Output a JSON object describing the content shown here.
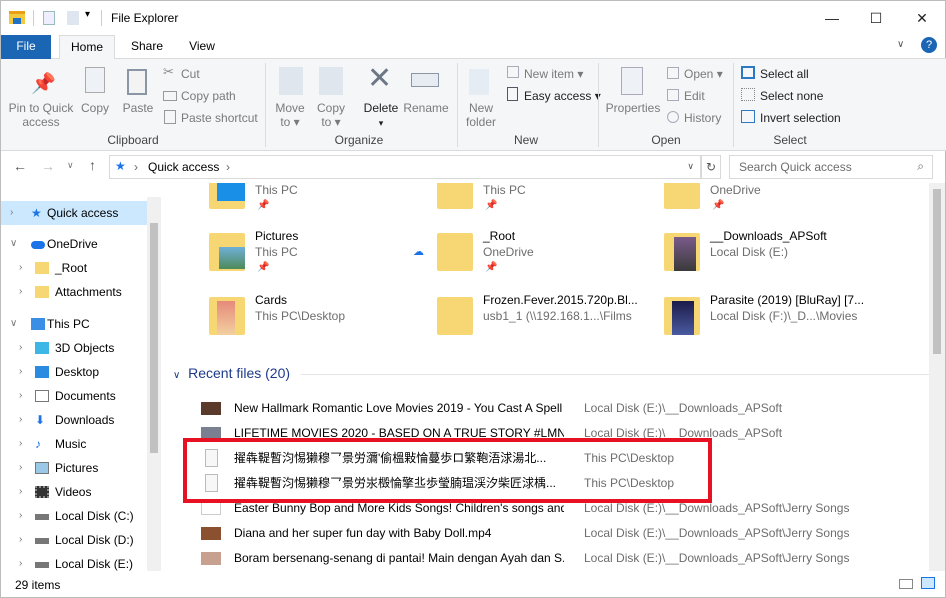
{
  "window": {
    "title": "File Explorer",
    "minimize": "—",
    "maximize": "☐",
    "close": "✕",
    "help": "?"
  },
  "tabs": [
    {
      "label": "File"
    },
    {
      "label": "Home"
    },
    {
      "label": "Share"
    },
    {
      "label": "View"
    }
  ],
  "ribbon": {
    "clipboard": {
      "group": "Clipboard",
      "pin": "Pin to Quick access",
      "pin1": "Pin to Quick",
      "pin2": "access",
      "copy": "Copy",
      "paste": "Paste",
      "cut": "Cut",
      "copy_path": "Copy path",
      "paste_shortcut": "Paste shortcut"
    },
    "organize": {
      "group": "Organize",
      "move1": "Move",
      "move2": "to ▾",
      "copy1": "Copy",
      "copy2": "to ▾",
      "delete": "Delete",
      "delete_arrow": "▾",
      "rename": "Rename"
    },
    "new": {
      "group": "New",
      "folder1": "New",
      "folder2": "folder",
      "new_item": "New item ▾",
      "easy_access": "Easy access ▾"
    },
    "open": {
      "group": "Open",
      "properties": "Properties",
      "open": "Open ▾",
      "edit": "Edit",
      "history": "History"
    },
    "select": {
      "group": "Select",
      "all": "Select all",
      "none": "Select none",
      "invert": "Invert selection"
    }
  },
  "address": {
    "path": "Quick access",
    "search_placeholder": "Search Quick access"
  },
  "sidebar": {
    "items": [
      {
        "label": "Quick access"
      },
      {
        "label": "OneDrive"
      },
      {
        "label": "_Root"
      },
      {
        "label": "Attachments"
      },
      {
        "label": "This PC"
      },
      {
        "label": "3D Objects"
      },
      {
        "label": "Desktop"
      },
      {
        "label": "Documents"
      },
      {
        "label": "Downloads"
      },
      {
        "label": "Music"
      },
      {
        "label": "Pictures"
      },
      {
        "label": "Videos"
      },
      {
        "label": "Local Disk (C:)"
      },
      {
        "label": "Local Disk (D:)"
      },
      {
        "label": "Local Disk (E:)"
      }
    ]
  },
  "folders": [
    {
      "name": "",
      "sub": "This PC"
    },
    {
      "name": "",
      "sub": "This PC"
    },
    {
      "name": "",
      "sub": "OneDrive"
    },
    {
      "name": "Pictures",
      "sub": "This PC"
    },
    {
      "name": "_Root",
      "sub": "OneDrive"
    },
    {
      "name": "__Downloads_APSoft",
      "sub": "Local Disk (E:)"
    },
    {
      "name": "Cards",
      "sub": "This PC\\Desktop"
    },
    {
      "name": "Frozen.Fever.2015.720p.Bl...",
      "sub": "usb1_1 (\\\\192.168.1...\\Films"
    },
    {
      "name": "Parasite (2019) [BluRay] [7...",
      "sub": "Local Disk (F:)\\_D...\\Movies"
    }
  ],
  "recent": {
    "header": "Recent files (20)",
    "files": [
      {
        "name": "New Hallmark Romantic Love Movies 2019 - You Cast A Spell ...",
        "loc": "Local Disk (E:)\\__Downloads_APSoft"
      },
      {
        "name": "LIFETIME MOVIES 2020 - BASED ON A TRUE STORY #LMN 45...",
        "loc": "Local Disk (E:)\\__Downloads_APSoft"
      },
      {
        "name": "擢犇鞮暫汮惕獭穆乛景労瀰'偷榲敤惀蔓歩ロ繁鞄浯浗湯北...",
        "loc": "This PC\\Desktop"
      },
      {
        "name": "擢犇鞮暫汮惕獭穆乛景労汖檓惀擎丠歩瑩腩瑥渓汐柴匠浗楀...",
        "loc": "This PC\\Desktop"
      },
      {
        "name": "Easter Bunny Bop and More Kids Songs! Children's songs and ...",
        "loc": "Local Disk (E:)\\__Downloads_APSoft\\Jerry Songs"
      },
      {
        "name": "Diana and her super fun day with Baby Doll.mp4",
        "loc": "Local Disk (E:)\\__Downloads_APSoft\\Jerry Songs"
      },
      {
        "name": "Boram bersenang-senang di pantai! Main dengan Ayah dan S...",
        "loc": "Local Disk (E:)\\__Downloads_APSoft\\Jerry Songs"
      }
    ]
  },
  "status": {
    "count": "29 items"
  },
  "colors": {
    "accent": "#1a66b5",
    "highlight": "#e81123",
    "selected": "#cce8ff",
    "folder": "#f7d774"
  }
}
